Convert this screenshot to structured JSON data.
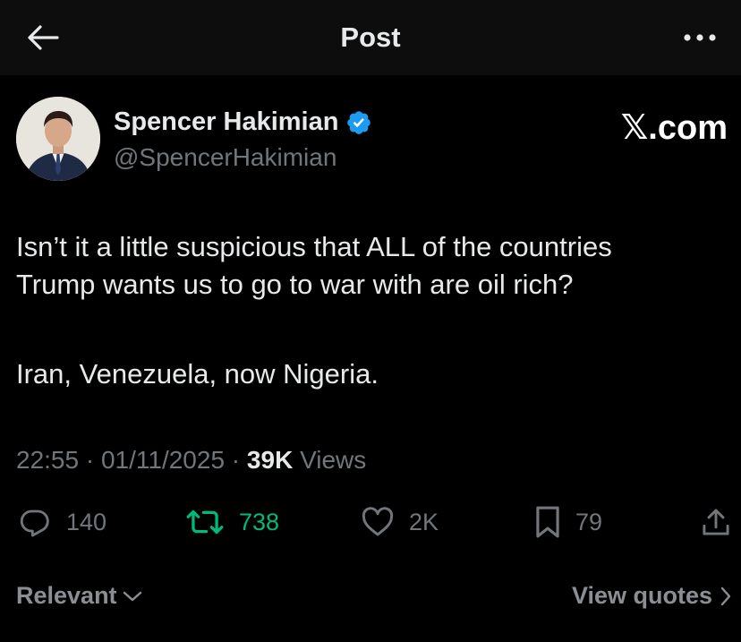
{
  "header": {
    "title": "Post",
    "back_icon": "arrow-left-icon",
    "more_icon": "more-horizontal-icon"
  },
  "author": {
    "name": "Spencer Hakimian",
    "handle": "@SpencerHakimian",
    "verified_icon": "verified-badge-icon",
    "verified_color": "#1d9bf0"
  },
  "brand": "𝕏.com",
  "tweet": {
    "line1": "Isn’t it a little suspicious that ALL of the countries",
    "line2": "Trump wants us to go to war with are oil rich?",
    "line3": "Iran, Venezuela, now Nigeria."
  },
  "meta": {
    "time": "22:55",
    "sep1": " · ",
    "date": "01/11/2025",
    "sep2": " · ",
    "views_count": "39K",
    "views_label": " Views"
  },
  "actions": {
    "reply": {
      "icon": "reply-icon",
      "count": "140"
    },
    "retweet": {
      "icon": "retweet-icon",
      "count": "738",
      "color": "#00ba7c"
    },
    "like": {
      "icon": "heart-icon",
      "count": "2K"
    },
    "bookmark": {
      "icon": "bookmark-icon",
      "count": "79"
    },
    "share": {
      "icon": "share-icon"
    }
  },
  "footer": {
    "sort_label": "Relevant",
    "quotes_label": "View quotes"
  },
  "colors": {
    "background": "#000000",
    "header_bg": "#0d0d0d",
    "text_primary": "#e7e9ea",
    "text_secondary": "#71767b"
  }
}
